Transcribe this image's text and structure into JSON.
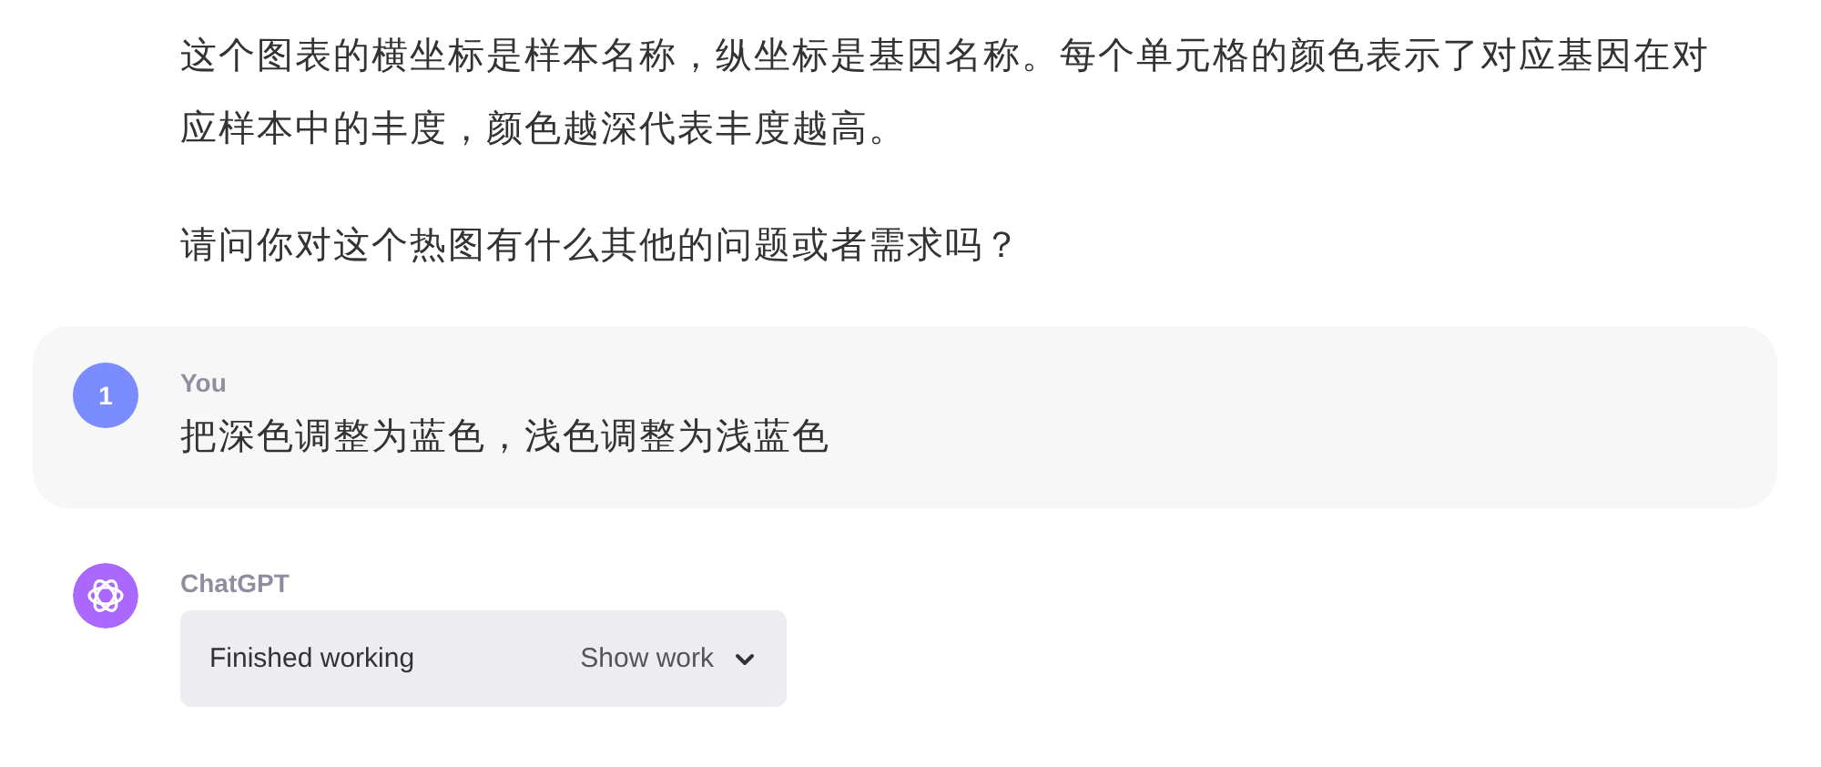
{
  "previous_answer": {
    "paragraphs": [
      "这个图表的横坐标是样本名称，纵坐标是基因名称。每个单元格的颜色表示了对应基因在对应样本中的丰度，颜色越深代表丰度越高。",
      "请问你对这个热图有什么其他的问题或者需求吗？"
    ]
  },
  "user_message": {
    "avatar": "1",
    "author": "You",
    "text": "把深色调整为蓝色，浅色调整为浅蓝色"
  },
  "assistant_message": {
    "author": "ChatGPT",
    "work": {
      "status": "Finished working",
      "toggle": "Show work",
      "expanded": false
    }
  }
}
